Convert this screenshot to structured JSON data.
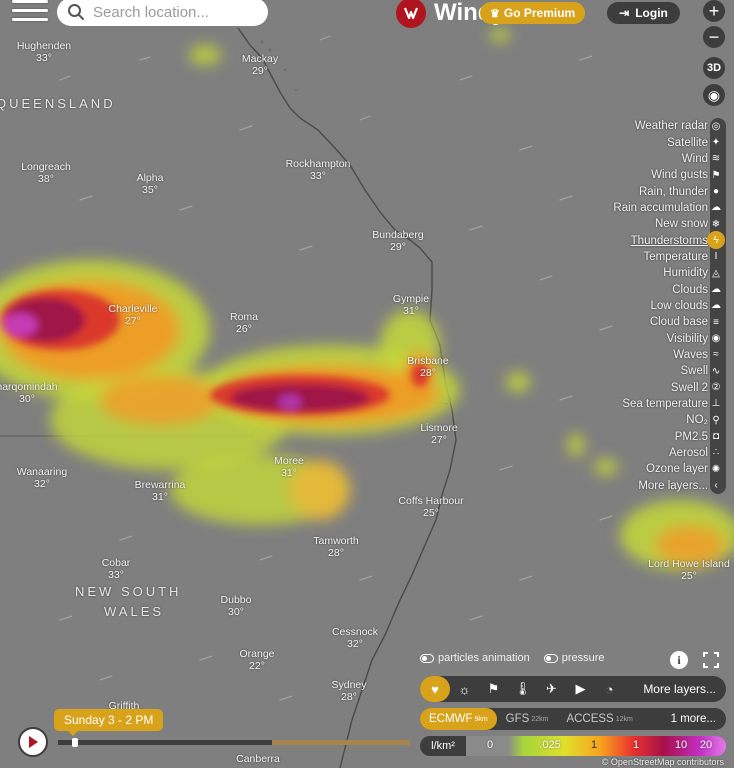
{
  "search": {
    "placeholder": "Search location..."
  },
  "brand": {
    "name": "Windy"
  },
  "header": {
    "premium_label": "Go Premium",
    "login_label": "Login"
  },
  "zoom": {
    "in": "+",
    "out": "−"
  },
  "view_3d": "3D",
  "cities": [
    {
      "name": "Hughenden",
      "temp": "33°"
    },
    {
      "name": "Mackay",
      "temp": "29°"
    },
    {
      "name": "Longreach",
      "temp": "38°"
    },
    {
      "name": "Alpha",
      "temp": "35°"
    },
    {
      "name": "Rockhampton",
      "temp": "33°"
    },
    {
      "name": "Bundaberg",
      "temp": "29°"
    },
    {
      "name": "Charleville",
      "temp": "27°"
    },
    {
      "name": "Roma",
      "temp": "26°"
    },
    {
      "name": "Gympie",
      "temp": "31°"
    },
    {
      "name": "Brisbane",
      "temp": "28°"
    },
    {
      "name": "harqomindah",
      "temp": "30°"
    },
    {
      "name": "Lismore",
      "temp": "27°"
    },
    {
      "name": "Moree",
      "temp": "31°"
    },
    {
      "name": "Wanaaring",
      "temp": "32°"
    },
    {
      "name": "Brewarrina",
      "temp": "31°"
    },
    {
      "name": "Coffs Harbour",
      "temp": "25°"
    },
    {
      "name": "Tamworth",
      "temp": "28°"
    },
    {
      "name": "Cobar",
      "temp": "33°"
    },
    {
      "name": "Dubbo",
      "temp": "30°"
    },
    {
      "name": "Cessnock",
      "temp": "32°"
    },
    {
      "name": "Orange",
      "temp": "22°"
    },
    {
      "name": "Sydney",
      "temp": "28°"
    },
    {
      "name": "Lord Howe Island",
      "temp": "25°"
    },
    {
      "name": "Griffith",
      "temp": ""
    },
    {
      "name": "Canberra",
      "temp": ""
    }
  ],
  "regions": {
    "qld": "QUEENSLAND",
    "nsw1": "NEW SOUTH",
    "nsw2": "WALES"
  },
  "layers": [
    {
      "label": "Weather radar",
      "icon": "radar-icon"
    },
    {
      "label": "Satellite",
      "icon": "satellite-icon"
    },
    {
      "label": "Wind",
      "icon": "wind-icon"
    },
    {
      "label": "Wind gusts",
      "icon": "flag-icon"
    },
    {
      "label": "Rain, thunder",
      "icon": "raindrop-icon"
    },
    {
      "label": "Rain accumulation",
      "icon": "rain-cloud-icon"
    },
    {
      "label": "New snow",
      "icon": "snowflake-icon"
    },
    {
      "label": "Thunderstorms",
      "icon": "thunderstorm-icon",
      "active": true
    },
    {
      "label": "Temperature",
      "icon": "thermometer-icon"
    },
    {
      "label": "Humidity",
      "icon": "humidity-icon"
    },
    {
      "label": "Clouds",
      "icon": "cloud-icon"
    },
    {
      "label": "Low clouds",
      "icon": "low-cloud-icon"
    },
    {
      "label": "Cloud base",
      "icon": "cloud-base-icon"
    },
    {
      "label": "Visibility",
      "icon": "eye-icon"
    },
    {
      "label": "Waves",
      "icon": "waves-icon"
    },
    {
      "label": "Swell",
      "icon": "swell-icon"
    },
    {
      "label": "Swell 2",
      "icon": "swell2-icon"
    },
    {
      "label": "Sea temperature",
      "icon": "sea-temp-icon"
    },
    {
      "label": "NO₂",
      "icon": "no2-icon"
    },
    {
      "label": "PM2.5",
      "icon": "pm25-icon"
    },
    {
      "label": "Aerosol",
      "icon": "aerosol-icon"
    },
    {
      "label": "Ozone layer",
      "icon": "ozone-icon"
    },
    {
      "label": "More layers...",
      "icon": "chevron-left-icon"
    }
  ],
  "toggles": {
    "particles": "particles animation",
    "pressure": "pressure"
  },
  "toolbar": {
    "more_label": "More layers..."
  },
  "models": [
    {
      "name": "ECMWF",
      "res": "9km",
      "active": true
    },
    {
      "name": "GFS",
      "res": "22km"
    },
    {
      "name": "ACCESS",
      "res": "12km"
    }
  ],
  "models_more": "1 more...",
  "legend": {
    "unit": "l/km²",
    "ticks": [
      "0",
      ".025",
      "1",
      "1",
      "10",
      "20"
    ]
  },
  "timeline": {
    "label": "Sunday 3 - 2 PM",
    "progress": 0.04
  },
  "attribution": "© OpenStreetMap contributors",
  "colors": {
    "accent": "#d9a21b",
    "panel": "#3d3d3d",
    "map_bg": "#7f7f7f",
    "brand_red": "#b0141e"
  }
}
